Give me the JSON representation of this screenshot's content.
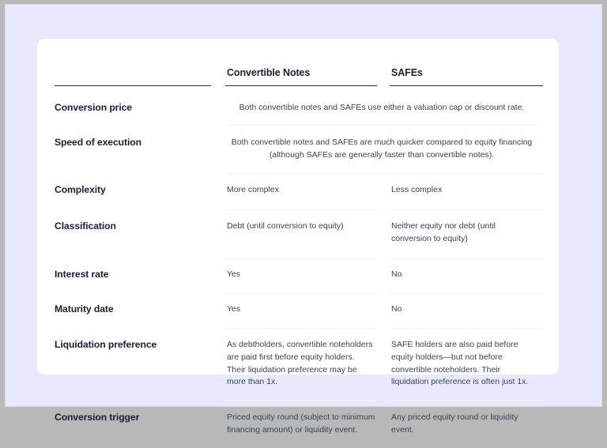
{
  "canvas": {
    "outer_background": "#b8b8b8",
    "page_background": "#e8e9fc",
    "card_background": "#ffffff",
    "heading_color": "#1a1f36",
    "body_text_color": "#3c4257",
    "header_rule_color": "#2c2f3a",
    "row_rule_color": "#f0f1f5"
  },
  "table": {
    "columns": [
      {
        "key": "attribute",
        "label": ""
      },
      {
        "key": "convertible_notes",
        "label": "Convertible Notes"
      },
      {
        "key": "safes",
        "label": "SAFEs"
      }
    ],
    "rows": [
      {
        "label": "Conversion price",
        "merged": true,
        "merged_value": "Both convertible notes and SAFEs use either a valuation cap or discount rate.",
        "convertible_notes": "",
        "safes": ""
      },
      {
        "label": "Speed of execution",
        "merged": true,
        "merged_value": "Both convertible notes and SAFEs are much quicker compared to equity financing (although SAFEs are generally faster than convertible notes).",
        "convertible_notes": "",
        "safes": ""
      },
      {
        "label": "Complexity",
        "merged": false,
        "merged_value": "",
        "convertible_notes": "More complex",
        "safes": "Less complex"
      },
      {
        "label": "Classification",
        "merged": false,
        "merged_value": "",
        "convertible_notes": "Debt (until conversion to equity)",
        "safes": "Neither equity nor debt (until conversion to equity)"
      },
      {
        "label": "Interest rate",
        "merged": false,
        "merged_value": "",
        "convertible_notes": "Yes",
        "safes": "No"
      },
      {
        "label": "Maturity date",
        "merged": false,
        "merged_value": "",
        "convertible_notes": "Yes",
        "safes": "No"
      },
      {
        "label": "Liquidation preference",
        "merged": false,
        "merged_value": "",
        "convertible_notes": "As debtholders, convertible noteholders are paid first before equity holders. Their liquidation preference may be more than 1x.",
        "safes": "SAFE holders are also paid before equity holders—but not before convertible noteholders. Their liquidation preference is often just 1x."
      },
      {
        "label": "Conversion trigger",
        "merged": false,
        "merged_value": "",
        "convertible_notes": "Priced equity round (subject to minimum financing amount) or liquidity event.",
        "safes": "Any priced equity round or liquidity event."
      }
    ]
  }
}
